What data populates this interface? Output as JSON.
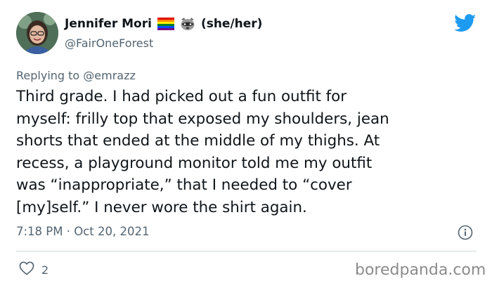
{
  "tweet": {
    "author_name": "Jennifer Mori",
    "pronouns": "(she/her)",
    "handle": "@FairOneForest",
    "reply_prefix": "Replying to",
    "reply_to": "@emrazz",
    "text": "Third grade. I had picked out a fun outfit for\nmyself: frilly top that exposed my shoulders, jean\nshorts that ended at the middle of my thighs. At\nrecess, a playground monitor told me my outfit\nwas “inappropriate,” that I needed to “cover\n[my]self.” I never wore the shirt again.",
    "timestamp": "7:18 PM · Oct 20, 2021",
    "like_count": "2"
  },
  "icons": {
    "author_emoji_1": "rainbow-flag-icon",
    "author_emoji_2": "raccoon-icon",
    "platform": "twitter-bird-icon",
    "info": "info-icon",
    "like": "heart-icon"
  },
  "watermark": "boredpanda.com",
  "colors": {
    "brand_blue": "#1d9bf0",
    "text_primary": "#0f1419",
    "text_secondary": "#536471",
    "divider": "#cfd9de"
  }
}
